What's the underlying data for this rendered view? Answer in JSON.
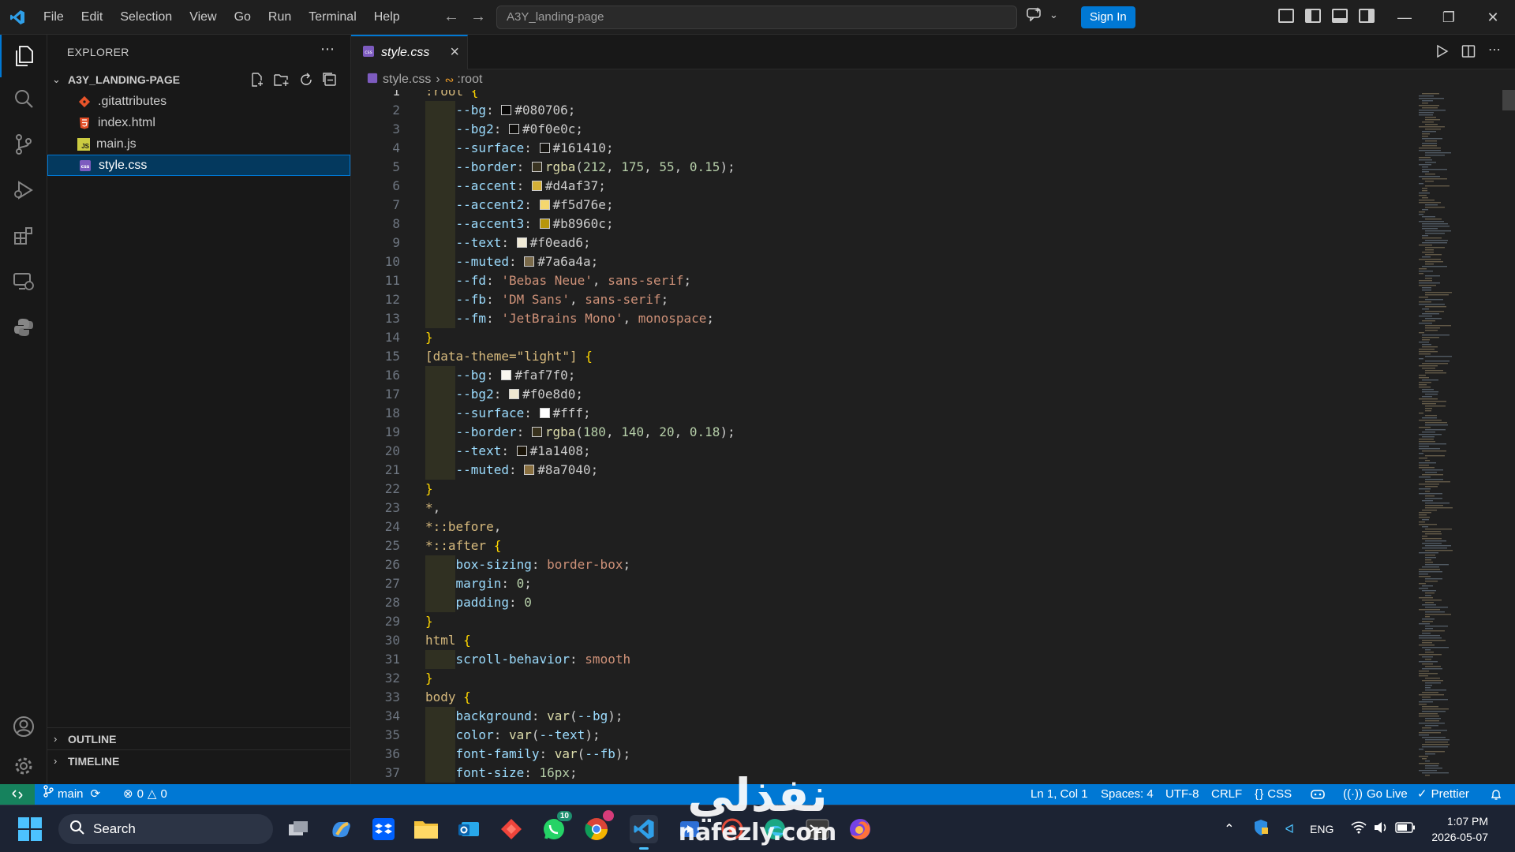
{
  "menu": [
    "File",
    "Edit",
    "Selection",
    "View",
    "Go",
    "Run",
    "Terminal",
    "Help"
  ],
  "command_center": {
    "text": "A3Y_landing-page"
  },
  "sign_in_label": "Sign In",
  "sidebar": {
    "title": "EXPLORER",
    "folder": "A3Y_LANDING-PAGE",
    "files": [
      {
        "name": ".gitattributes",
        "icon": "git-icon",
        "color": "#e8542a"
      },
      {
        "name": "index.html",
        "icon": "html-icon",
        "color": "#e44d26"
      },
      {
        "name": "main.js",
        "icon": "js-icon",
        "color": "#cbcb41"
      },
      {
        "name": "style.css",
        "icon": "css-icon",
        "color": "#7d5bbf"
      }
    ],
    "outline_label": "OUTLINE",
    "timeline_label": "TIMELINE"
  },
  "tab": {
    "label": "style.css"
  },
  "breadcrumb": {
    "file": "style.css",
    "symbol": ":root"
  },
  "code_lines": [
    [
      [
        "t-sel",
        ":root "
      ],
      [
        "t-brace",
        "{"
      ]
    ],
    [
      [
        "t-prop",
        "--bg"
      ],
      [
        "t-punc",
        ": "
      ],
      [
        "sw",
        "#080706"
      ],
      [
        "t-plain",
        "#080706"
      ],
      [
        "t-punc",
        ";"
      ]
    ],
    [
      [
        "t-prop",
        "--bg2"
      ],
      [
        "t-punc",
        ": "
      ],
      [
        "sw",
        "#0f0e0c"
      ],
      [
        "t-plain",
        "#0f0e0c"
      ],
      [
        "t-punc",
        ";"
      ]
    ],
    [
      [
        "t-prop",
        "--surface"
      ],
      [
        "t-punc",
        ": "
      ],
      [
        "sw",
        "#161410"
      ],
      [
        "t-plain",
        "#161410"
      ],
      [
        "t-punc",
        ";"
      ]
    ],
    [
      [
        "t-prop",
        "--border"
      ],
      [
        "t-punc",
        ": "
      ],
      [
        "sw",
        "rgba(212,175,55,0.15)"
      ],
      [
        "t-fn",
        "rgba"
      ],
      [
        "t-punc",
        "("
      ],
      [
        "t-num",
        "212"
      ],
      [
        "t-punc",
        ", "
      ],
      [
        "t-num",
        "175"
      ],
      [
        "t-punc",
        ", "
      ],
      [
        "t-num",
        "55"
      ],
      [
        "t-punc",
        ", "
      ],
      [
        "t-num",
        "0.15"
      ],
      [
        "t-punc",
        ");"
      ]
    ],
    [
      [
        "t-prop",
        "--accent"
      ],
      [
        "t-punc",
        ": "
      ],
      [
        "sw",
        "#d4af37"
      ],
      [
        "t-plain",
        "#d4af37"
      ],
      [
        "t-punc",
        ";"
      ]
    ],
    [
      [
        "t-prop",
        "--accent2"
      ],
      [
        "t-punc",
        ": "
      ],
      [
        "sw",
        "#f5d76e"
      ],
      [
        "t-plain",
        "#f5d76e"
      ],
      [
        "t-punc",
        ";"
      ]
    ],
    [
      [
        "t-prop",
        "--accent3"
      ],
      [
        "t-punc",
        ": "
      ],
      [
        "sw",
        "#b8960c"
      ],
      [
        "t-plain",
        "#b8960c"
      ],
      [
        "t-punc",
        ";"
      ]
    ],
    [
      [
        "t-prop",
        "--text"
      ],
      [
        "t-punc",
        ": "
      ],
      [
        "sw",
        "#f0ead6"
      ],
      [
        "t-plain",
        "#f0ead6"
      ],
      [
        "t-punc",
        ";"
      ]
    ],
    [
      [
        "t-prop",
        "--muted"
      ],
      [
        "t-punc",
        ": "
      ],
      [
        "sw",
        "#7a6a4a"
      ],
      [
        "t-plain",
        "#7a6a4a"
      ],
      [
        "t-punc",
        ";"
      ]
    ],
    [
      [
        "t-prop",
        "--fd"
      ],
      [
        "t-punc",
        ": "
      ],
      [
        "t-val",
        "'Bebas Neue'"
      ],
      [
        "t-punc",
        ", "
      ],
      [
        "t-val",
        "sans-serif"
      ],
      [
        "t-punc",
        ";"
      ]
    ],
    [
      [
        "t-prop",
        "--fb"
      ],
      [
        "t-punc",
        ": "
      ],
      [
        "t-val",
        "'DM Sans'"
      ],
      [
        "t-punc",
        ", "
      ],
      [
        "t-val",
        "sans-serif"
      ],
      [
        "t-punc",
        ";"
      ]
    ],
    [
      [
        "t-prop",
        "--fm"
      ],
      [
        "t-punc",
        ": "
      ],
      [
        "t-val",
        "'JetBrains Mono'"
      ],
      [
        "t-punc",
        ", "
      ],
      [
        "t-val",
        "monospace"
      ],
      [
        "t-punc",
        ";"
      ]
    ],
    [
      [
        "t-brace",
        "}"
      ]
    ],
    [
      [
        "t-sel",
        "[data-theme=\"light\"] "
      ],
      [
        "t-brace",
        "{"
      ]
    ],
    [
      [
        "t-prop",
        "--bg"
      ],
      [
        "t-punc",
        ": "
      ],
      [
        "sw",
        "#faf7f0"
      ],
      [
        "t-plain",
        "#faf7f0"
      ],
      [
        "t-punc",
        ";"
      ]
    ],
    [
      [
        "t-prop",
        "--bg2"
      ],
      [
        "t-punc",
        ": "
      ],
      [
        "sw",
        "#f0e8d0"
      ],
      [
        "t-plain",
        "#f0e8d0"
      ],
      [
        "t-punc",
        ";"
      ]
    ],
    [
      [
        "t-prop",
        "--surface"
      ],
      [
        "t-punc",
        ": "
      ],
      [
        "sw",
        "#ffffff"
      ],
      [
        "t-plain",
        "#fff"
      ],
      [
        "t-punc",
        ";"
      ]
    ],
    [
      [
        "t-prop",
        "--border"
      ],
      [
        "t-punc",
        ": "
      ],
      [
        "sw",
        "rgba(180,140,20,0.18)"
      ],
      [
        "t-fn",
        "rgba"
      ],
      [
        "t-punc",
        "("
      ],
      [
        "t-num",
        "180"
      ],
      [
        "t-punc",
        ", "
      ],
      [
        "t-num",
        "140"
      ],
      [
        "t-punc",
        ", "
      ],
      [
        "t-num",
        "20"
      ],
      [
        "t-punc",
        ", "
      ],
      [
        "t-num",
        "0.18"
      ],
      [
        "t-punc",
        ");"
      ]
    ],
    [
      [
        "t-prop",
        "--text"
      ],
      [
        "t-punc",
        ": "
      ],
      [
        "sw",
        "#1a1408"
      ],
      [
        "t-plain",
        "#1a1408"
      ],
      [
        "t-punc",
        ";"
      ]
    ],
    [
      [
        "t-prop",
        "--muted"
      ],
      [
        "t-punc",
        ": "
      ],
      [
        "sw",
        "#8a7040"
      ],
      [
        "t-plain",
        "#8a7040"
      ],
      [
        "t-punc",
        ";"
      ]
    ],
    [
      [
        "t-brace",
        "}"
      ]
    ],
    [
      [
        "t-sel",
        "*"
      ],
      [
        "t-punc",
        ","
      ]
    ],
    [
      [
        "t-sel",
        "*::before"
      ],
      [
        "t-punc",
        ","
      ]
    ],
    [
      [
        "t-sel",
        "*::after "
      ],
      [
        "t-brace",
        "{"
      ]
    ],
    [
      [
        "t-prop",
        "box-sizing"
      ],
      [
        "t-punc",
        ": "
      ],
      [
        "t-val",
        "border-box"
      ],
      [
        "t-punc",
        ";"
      ]
    ],
    [
      [
        "t-prop",
        "margin"
      ],
      [
        "t-punc",
        ": "
      ],
      [
        "t-num",
        "0"
      ],
      [
        "t-punc",
        ";"
      ]
    ],
    [
      [
        "t-prop",
        "padding"
      ],
      [
        "t-punc",
        ": "
      ],
      [
        "t-num",
        "0"
      ]
    ],
    [
      [
        "t-brace",
        "}"
      ]
    ],
    [
      [
        "t-sel",
        "html "
      ],
      [
        "t-brace",
        "{"
      ]
    ],
    [
      [
        "t-prop",
        "scroll-behavior"
      ],
      [
        "t-punc",
        ": "
      ],
      [
        "t-val",
        "smooth"
      ]
    ],
    [
      [
        "t-brace",
        "}"
      ]
    ],
    [
      [
        "t-sel",
        "body "
      ],
      [
        "t-brace",
        "{"
      ]
    ],
    [
      [
        "t-prop",
        "background"
      ],
      [
        "t-punc",
        ": "
      ],
      [
        "t-fn",
        "var"
      ],
      [
        "t-punc",
        "("
      ],
      [
        "t-prop",
        "--bg"
      ],
      [
        "t-punc",
        ");"
      ]
    ],
    [
      [
        "t-prop",
        "color"
      ],
      [
        "t-punc",
        ": "
      ],
      [
        "t-fn",
        "var"
      ],
      [
        "t-punc",
        "("
      ],
      [
        "t-prop",
        "--text"
      ],
      [
        "t-punc",
        ");"
      ]
    ],
    [
      [
        "t-prop",
        "font-family"
      ],
      [
        "t-punc",
        ": "
      ],
      [
        "t-fn",
        "var"
      ],
      [
        "t-punc",
        "("
      ],
      [
        "t-prop",
        "--fb"
      ],
      [
        "t-punc",
        ");"
      ]
    ],
    [
      [
        "t-prop",
        "font-size"
      ],
      [
        "t-punc",
        ": "
      ],
      [
        "t-num",
        "16px"
      ],
      [
        "t-punc",
        ";"
      ]
    ]
  ],
  "indented_lines": [
    2,
    3,
    4,
    5,
    6,
    7,
    8,
    9,
    10,
    11,
    12,
    13,
    16,
    17,
    18,
    19,
    20,
    21,
    26,
    27,
    28,
    31,
    34,
    35,
    36,
    37
  ],
  "status": {
    "branch": "main",
    "errors": "0",
    "warnings": "0",
    "position": "Ln 1, Col 1",
    "spaces": "Spaces: 4",
    "encoding": "UTF-8",
    "eol": "CRLF",
    "language": "CSS",
    "golive": "Go Live",
    "prettier": "Prettier"
  },
  "taskbar": {
    "search_label": "Search",
    "whatsapp_badge": "10",
    "time": "1:07 PM",
    "date": "2026-05-07",
    "lang": "ENG"
  },
  "watermark": {
    "arabic": "نفذلي",
    "latin": "nafezly.com"
  },
  "colors": {
    "accent": "#0078d4",
    "statusbar": "#0078d4",
    "editor_bg": "#1f1f1f"
  }
}
